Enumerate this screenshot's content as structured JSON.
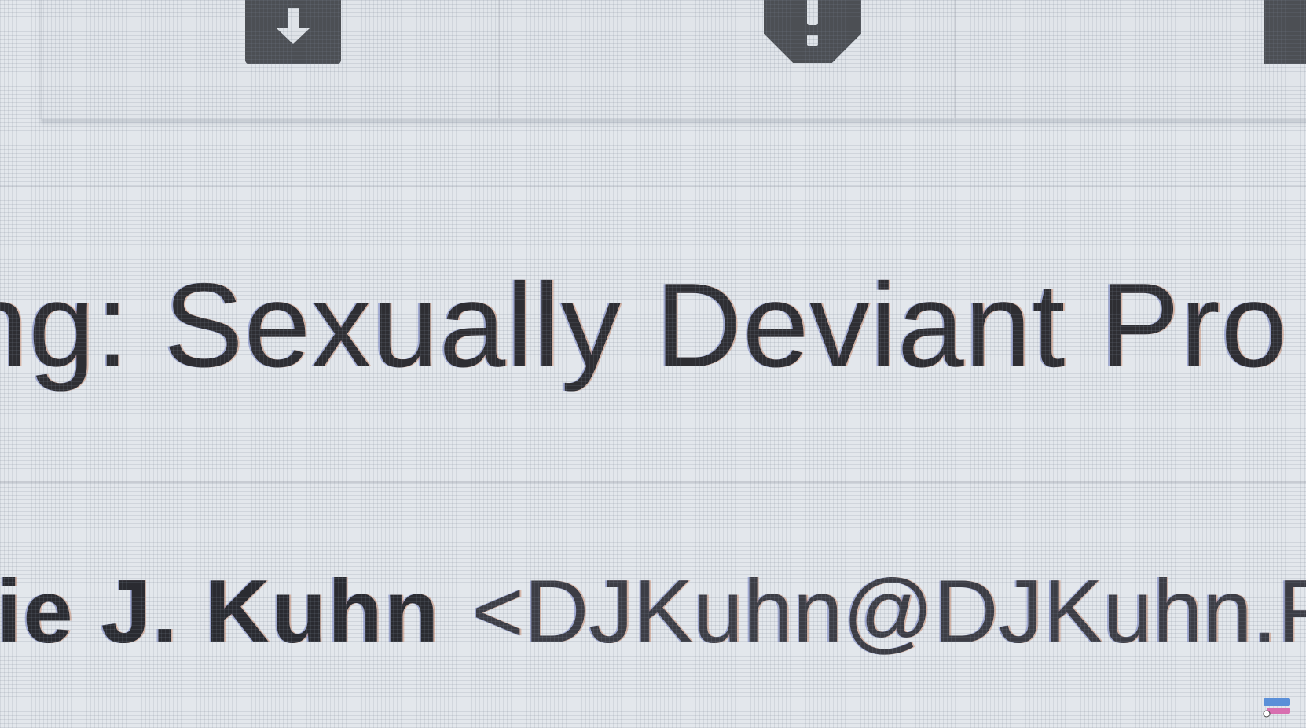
{
  "toolbar": {
    "buttons": [
      {
        "name": "archive",
        "icon": "archive-download-icon"
      },
      {
        "name": "report-spam",
        "icon": "report-spam-icon"
      },
      {
        "name": "delete",
        "icon": "delete-icon"
      }
    ]
  },
  "message": {
    "subject_visible": "ing: Sexually Deviant Pro",
    "sender_name_visible": "bie J. Kuhn",
    "sender_email_visible": "<DJKuhn@DJKuhn.F"
  },
  "colors": {
    "background": "#e3e7ec",
    "icon_fill": "#4c4f54",
    "text": "#2e2e33"
  }
}
